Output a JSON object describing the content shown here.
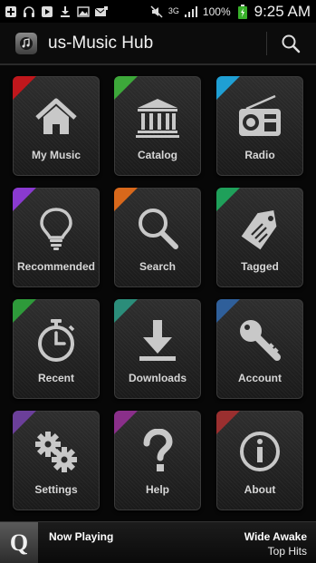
{
  "status_bar": {
    "network_type": "3G",
    "battery_percent": "100%",
    "time": "9:25 AM",
    "notification_icons": [
      "add-icon",
      "headphones-icon",
      "play-icon",
      "download-icon",
      "image-icon",
      "email-icon"
    ]
  },
  "app_bar": {
    "title": "us-Music Hub",
    "search_icon": "search-icon"
  },
  "tiles": [
    {
      "label": "My Music",
      "icon": "home-icon",
      "accent": "#c0171c"
    },
    {
      "label": "Catalog",
      "icon": "library-icon",
      "accent": "#3da83a"
    },
    {
      "label": "Radio",
      "icon": "radio-icon",
      "accent": "#1f9fd4"
    },
    {
      "label": "Recommended",
      "icon": "lightbulb-icon",
      "accent": "#8a3ad0"
    },
    {
      "label": "Search",
      "icon": "search-icon",
      "accent": "#d8681b"
    },
    {
      "label": "Tagged",
      "icon": "tag-icon",
      "accent": "#1fa05a"
    },
    {
      "label": "Recent",
      "icon": "stopwatch-icon",
      "accent": "#2e9a3a"
    },
    {
      "label": "Downloads",
      "icon": "download-icon",
      "accent": "#2b8d7a"
    },
    {
      "label": "Account",
      "icon": "key-icon",
      "accent": "#2f5f9a"
    },
    {
      "label": "Settings",
      "icon": "gears-icon",
      "accent": "#6b3f9a"
    },
    {
      "label": "Help",
      "icon": "question-icon",
      "accent": "#8a2f8a"
    },
    {
      "label": "About",
      "icon": "info-icon",
      "accent": "#9a2f2f"
    }
  ],
  "now_playing": {
    "logo_letter": "Q",
    "label": "Now Playing",
    "song": "Wide Awake",
    "artist": "Top Hits"
  }
}
